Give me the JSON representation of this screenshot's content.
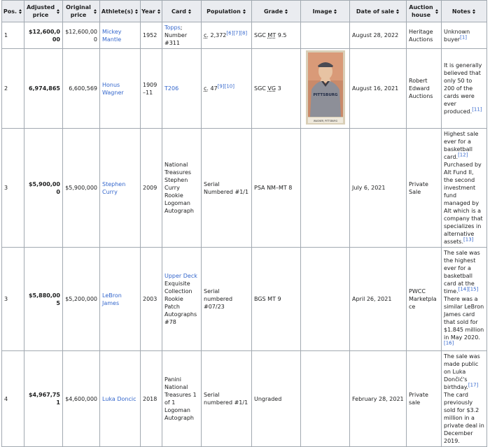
{
  "headers": [
    {
      "label": "Pos."
    },
    {
      "label": "Adjusted price"
    },
    {
      "label": "Original price"
    },
    {
      "label": "Athlete(s)"
    },
    {
      "label": "Year"
    },
    {
      "label": "Card"
    },
    {
      "label": "Population"
    },
    {
      "label": "Grade"
    },
    {
      "label": "Image"
    },
    {
      "label": "Date of sale"
    },
    {
      "label": "Auction house"
    },
    {
      "label": "Notes"
    }
  ],
  "rows": [
    {
      "pos": "1",
      "adjusted": "$12,600,000",
      "original": "$12,600,000",
      "athlete": "Mickey Mantle",
      "year": "1952",
      "card_link": "Topps",
      "card_text": "; Number #311",
      "pop_prefix": "c.",
      "pop_value": " 2,372",
      "pop_refs": "[6][7][8]",
      "grade_a": "SGC",
      "grade_b": "MT",
      "grade_c": " 9.5",
      "date": "August 28, 2022",
      "house": "Heritage Auctions",
      "notes": "Unknown buyer",
      "notes_ref": "[1]"
    },
    {
      "pos": "2",
      "adjusted": "6,974,865",
      "original": "6,600,569",
      "athlete": "Honus Wagner",
      "year": "1909–11",
      "card_link": "T206",
      "pop_prefix": "c.",
      "pop_value": " 47",
      "pop_refs": "[9][10]",
      "grade_a": "SGC",
      "grade_b": "VG",
      "grade_c": " 3",
      "date": "August 16, 2021",
      "house": "Robert Edward Auctions",
      "notes": "It is generally believed that only 50 to 200 of the cards were ever produced.",
      "notes_ref": "[11]",
      "image_caption": "WAGNER, PITTSBURG",
      "image_jersey": "PITTSBURG"
    },
    {
      "pos": "3",
      "adjusted": "$5,900,000",
      "original": "$5,900,000",
      "athlete": "Stephen Curry",
      "year": "2009",
      "card": "National Treasures Stephen Curry Rookie Logoman Autograph",
      "population": "Serial Numbered #1/1",
      "grade": "PSA NM–MT 8",
      "date": "July 6, 2021",
      "house": "Private Sale",
      "notes": "Highest sale ever for a basketball card.",
      "notes_ref": "[12]",
      "notes2": " Purchased by Alt Fund II, the second investment fund managed by Alt which is a company that specializes in alternative assets.",
      "notes2_ref": "[13]"
    },
    {
      "pos": "3",
      "adjusted": "$5,880,005",
      "original": "$5,200,000",
      "athlete": "LeBron James",
      "year": "2003",
      "card_link": "Upper Deck",
      "card_text": " Exquisite Collection Rookie Patch Autographs #78",
      "population": "Serial numbered #07/23",
      "grade": "BGS MT 9",
      "date": "April 26, 2021",
      "house": "PWCC Marketplace",
      "notes": "The sale was the highest ever for a basketball card at the time.",
      "notes_ref": "[14][15]",
      "notes2": " There was a similar LeBron James card that sold for $1.845 million in May 2020.",
      "notes2_ref": "[16]"
    },
    {
      "pos": "4",
      "adjusted": "$4,967,751",
      "original": "$4,600,000",
      "athlete": "Luka Doncic",
      "year": "2018",
      "card": "Panini National Treasures 1 of 1 Logoman Autograph",
      "population": "Serial numbered #1/1",
      "grade": "Ungraded",
      "date": "February 28, 2021",
      "house": "Private sale",
      "notes": "The sale was made public on Luka Dončić's birthday.",
      "notes_ref": "[17]",
      "notes2": " The card previously sold for $3.2 million in a private deal in December 2019."
    }
  ]
}
